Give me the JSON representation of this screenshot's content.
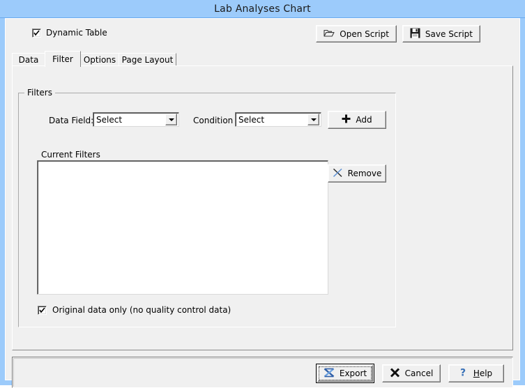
{
  "window": {
    "title": "Lab Analyses Chart",
    "titlebar_color": "#9ccbfb",
    "face_color": "#f0f0f0"
  },
  "toolbar": {
    "dynamic_table": {
      "label": "Dynamic Table",
      "checked": true,
      "icon": "checkmark-icon"
    },
    "open_script": {
      "label": "Open Script",
      "icon": "open-folder-icon"
    },
    "save_script": {
      "label": "Save Script",
      "icon": "floppy-disk-icon"
    }
  },
  "tabs": {
    "active": "Filter",
    "items": [
      {
        "label": "Data"
      },
      {
        "label": "Filter"
      },
      {
        "label": "Options"
      },
      {
        "label": "Page Layout"
      }
    ]
  },
  "filter_tab": {
    "group_title": "Filters",
    "data_field": {
      "label": "Data Field:",
      "value": "Select",
      "arrow_icon": "chevron-down-icon"
    },
    "condition": {
      "label": "Condition",
      "value": "Select",
      "arrow_icon": "chevron-down-icon"
    },
    "add_button": {
      "label": "Add",
      "icon": "plus-icon"
    },
    "current_filters": {
      "label": "Current Filters",
      "items": []
    },
    "remove_button": {
      "label": "Remove",
      "icon": "x-mark-icon"
    },
    "original_data_only": {
      "label": "Original data only (no quality control data)",
      "checked": true,
      "icon": "checkmark-icon"
    }
  },
  "footer": {
    "export": {
      "label": "Export",
      "icon": "export-icon",
      "is_default": true
    },
    "cancel": {
      "label": "Cancel",
      "icon": "x-bold-icon"
    },
    "help": {
      "label": "Help",
      "icon": "question-mark-icon",
      "accel": "H"
    }
  }
}
